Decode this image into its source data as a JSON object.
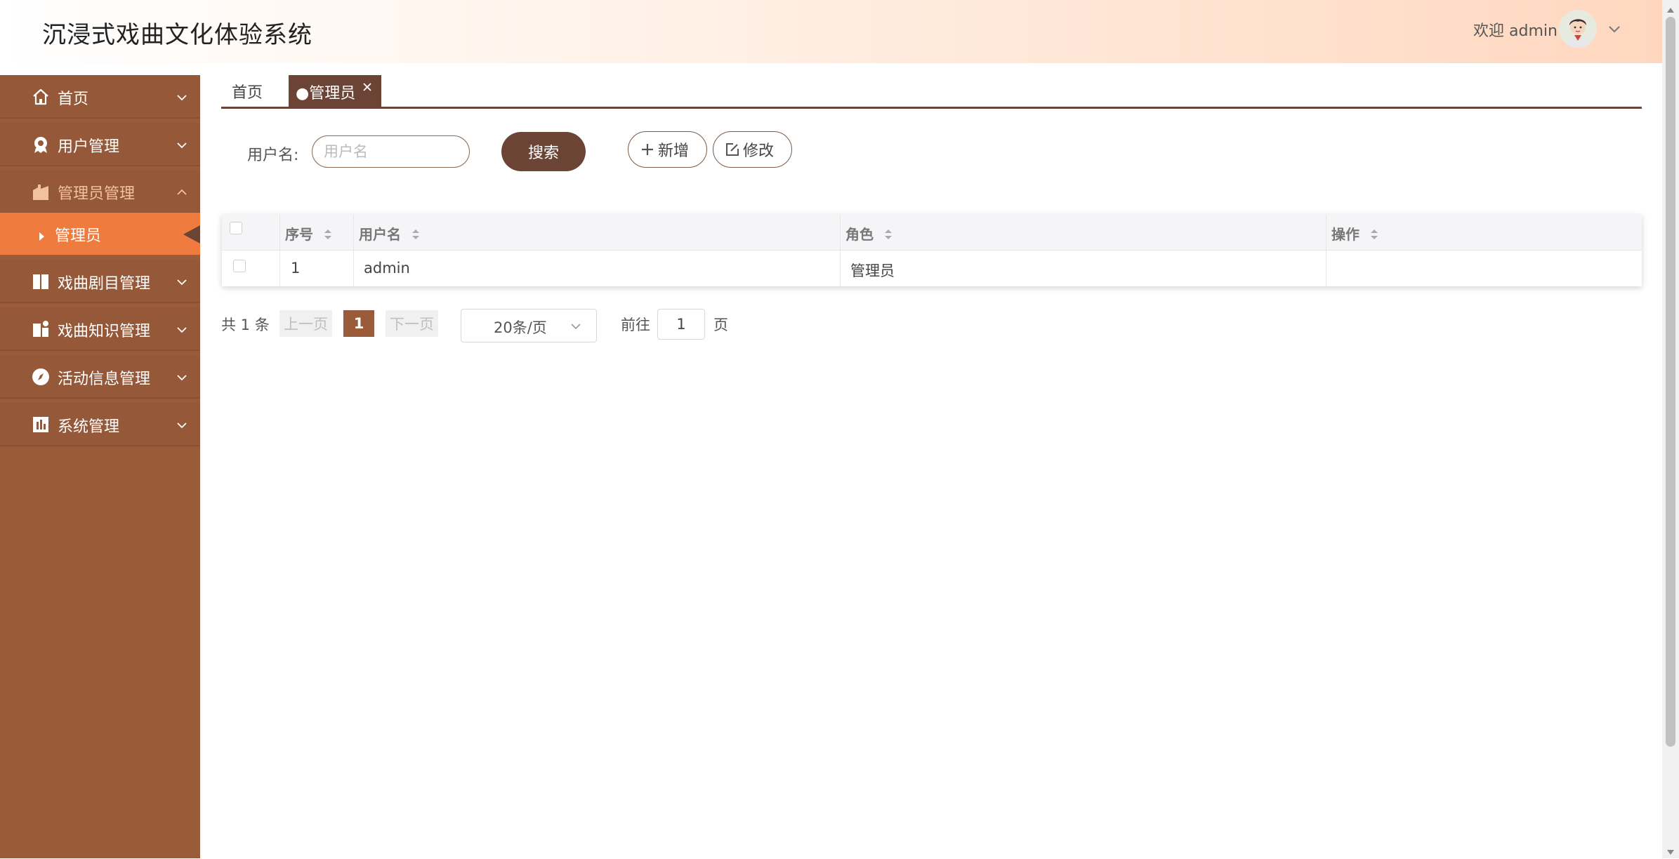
{
  "header": {
    "app_title": "沉浸式戏曲文化体验系统",
    "welcome": "欢迎 admin",
    "avatar_icon": "user-avatar-icon",
    "dropdown_icon": "chevron-down-icon"
  },
  "sidebar": {
    "items": [
      {
        "label": "首页",
        "icon": "home-icon",
        "expanded": false
      },
      {
        "label": "用户管理",
        "icon": "user-badge-icon",
        "expanded": false
      },
      {
        "label": "管理员管理",
        "icon": "building-icon",
        "expanded": true
      },
      {
        "label": "戏曲剧目管理",
        "icon": "book-icon",
        "expanded": false
      },
      {
        "label": "戏曲知识管理",
        "icon": "doc-icon",
        "expanded": false
      },
      {
        "label": "活动信息管理",
        "icon": "compass-icon",
        "expanded": false
      },
      {
        "label": "系统管理",
        "icon": "chart-icon",
        "expanded": false
      }
    ],
    "active_subitem": "管理员"
  },
  "tabs": {
    "home": "首页",
    "active": "●管理员"
  },
  "search": {
    "label": "用户名:",
    "placeholder": "用户名",
    "value": "",
    "search_button": "搜索",
    "add_button": "新增",
    "edit_button": "修改"
  },
  "table": {
    "columns": [
      "序号",
      "用户名",
      "角色",
      "操作"
    ],
    "rows": [
      {
        "index": "1",
        "username": "admin",
        "role": "管理员",
        "actions": ""
      }
    ]
  },
  "pagination": {
    "total": "共 1 条",
    "prev": "上一页",
    "current": "1",
    "next": "下一页",
    "page_size": "20条/页",
    "goto_label": "前往",
    "goto_value": "1",
    "page_suffix": "页"
  },
  "colors": {
    "sidebar_bg": "#9a5b3b",
    "active_item": "#f07b3f",
    "accent_dark": "#6b4436"
  }
}
